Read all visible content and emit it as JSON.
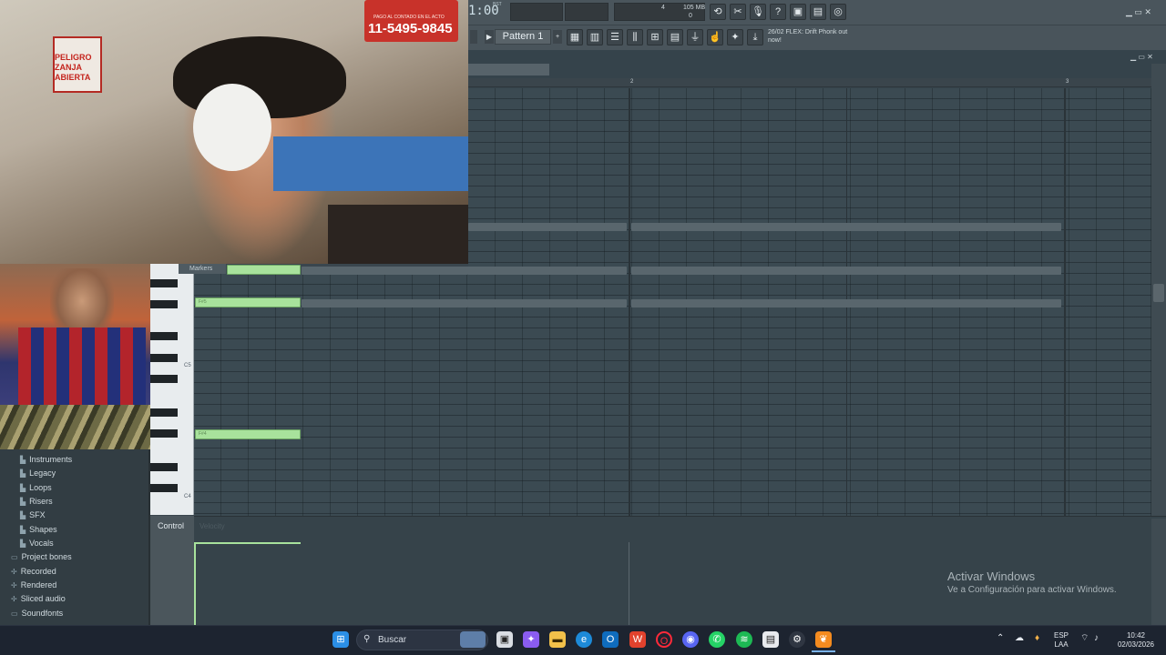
{
  "webcam": {
    "sign_text": "PELIGRO ZANJA ABIERTA",
    "phone_sub": "PAGO AL CONTADO EN EL ACTO",
    "phone_number": "11-5495-9845"
  },
  "toolbar": {
    "time": "1:00",
    "time_label": "BST",
    "cpu_value": "4",
    "ram": "105 MB",
    "voices": "0",
    "pattern_label": "Pattern 1",
    "hint_text": "26/02 FLEX: Drift Phonk out now!"
  },
  "piano_roll": {
    "ruler_marks": [
      "2",
      "3"
    ],
    "markers_label": "Markers",
    "key_labels": [
      "C5",
      "C4"
    ],
    "note_labels": [
      "F#5",
      "F#4"
    ],
    "control_label": "Control",
    "control_sub": "Velocity"
  },
  "browser": {
    "items": [
      {
        "label": "Instruments",
        "icon": "folder-icon"
      },
      {
        "label": "Legacy",
        "icon": "folder-icon"
      },
      {
        "label": "Loops",
        "icon": "folder-icon"
      },
      {
        "label": "Risers",
        "icon": "folder-icon"
      },
      {
        "label": "SFX",
        "icon": "folder-icon"
      },
      {
        "label": "Shapes",
        "icon": "folder-icon"
      },
      {
        "label": "Vocals",
        "icon": "folder-icon"
      },
      {
        "label": "Project bones",
        "icon": "folder-icon"
      },
      {
        "label": "Recorded",
        "icon": "plus-icon"
      },
      {
        "label": "Rendered",
        "icon": "plus-icon"
      },
      {
        "label": "Sliced audio",
        "icon": "plus-icon"
      },
      {
        "label": "Soundfonts",
        "icon": "folder-icon"
      }
    ]
  },
  "watermark": {
    "title": "Activar Windows",
    "subtitle": "Ve a Configuración para activar Windows."
  },
  "taskbar": {
    "search_placeholder": "Buscar",
    "lang_top": "ESP",
    "lang_bottom": "LAA",
    "time": "10:42",
    "date": "02/03/2026"
  },
  "colors": {
    "note_green": "#a8e29c",
    "roll_bg": "#3b4a52",
    "toolbar_bg": "#4a555c"
  }
}
